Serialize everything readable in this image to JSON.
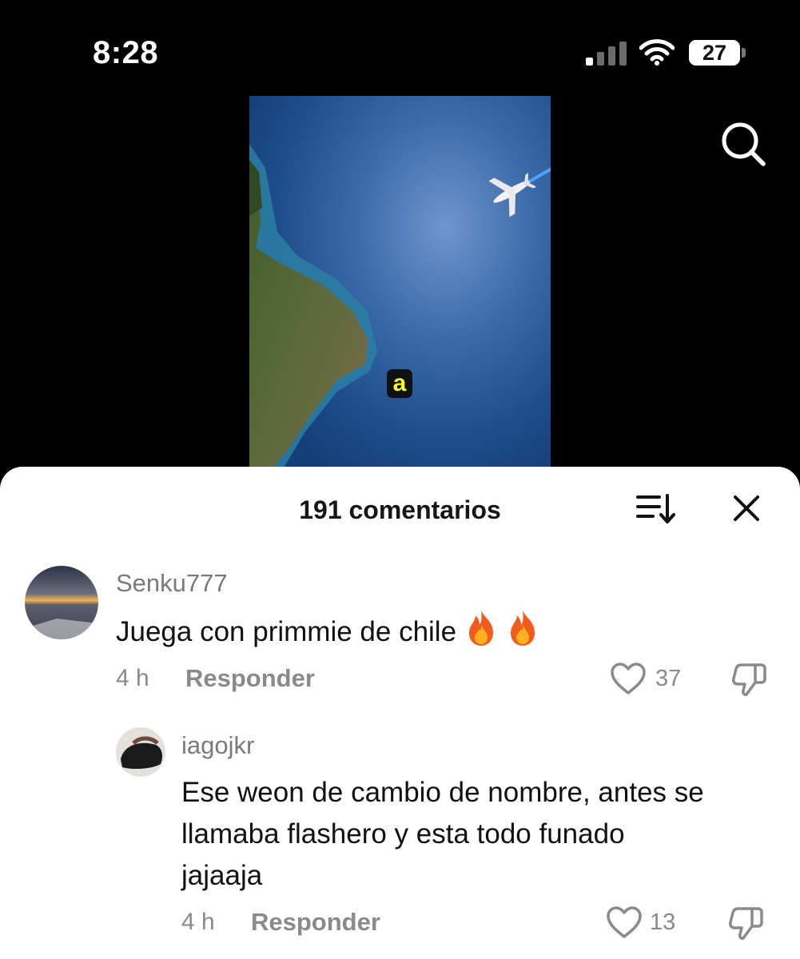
{
  "status_bar": {
    "time": "8:28",
    "battery_level": "27",
    "icons": [
      "cellular-signal-icon",
      "wifi-icon",
      "battery-icon"
    ]
  },
  "header": {
    "icons": [
      "search-icon"
    ]
  },
  "video": {
    "caption_letter": "a",
    "caption_color": "#f3ff2b"
  },
  "comments_panel": {
    "title": "191 comentarios",
    "icons": [
      "sort-icon",
      "close-icon"
    ],
    "comments": [
      {
        "username": "Senku777",
        "text": "Juega con primmie de chile",
        "emoji": [
          "fire-icon",
          "fire-icon"
        ],
        "time": "4 h",
        "reply_label": "Responder",
        "likes": "37"
      },
      {
        "username": "iagojkr",
        "text_lines": [
          "Ese weon de cambio de nombre, antes se",
          "llamaba flashero y esta todo funado",
          "jajaaja"
        ],
        "time": "4 h",
        "reply_label": "Responder",
        "likes": "13"
      }
    ]
  },
  "colors": {
    "background": "#000000",
    "sheet": "#ffffff",
    "muted_text": "#8a8a8a"
  }
}
